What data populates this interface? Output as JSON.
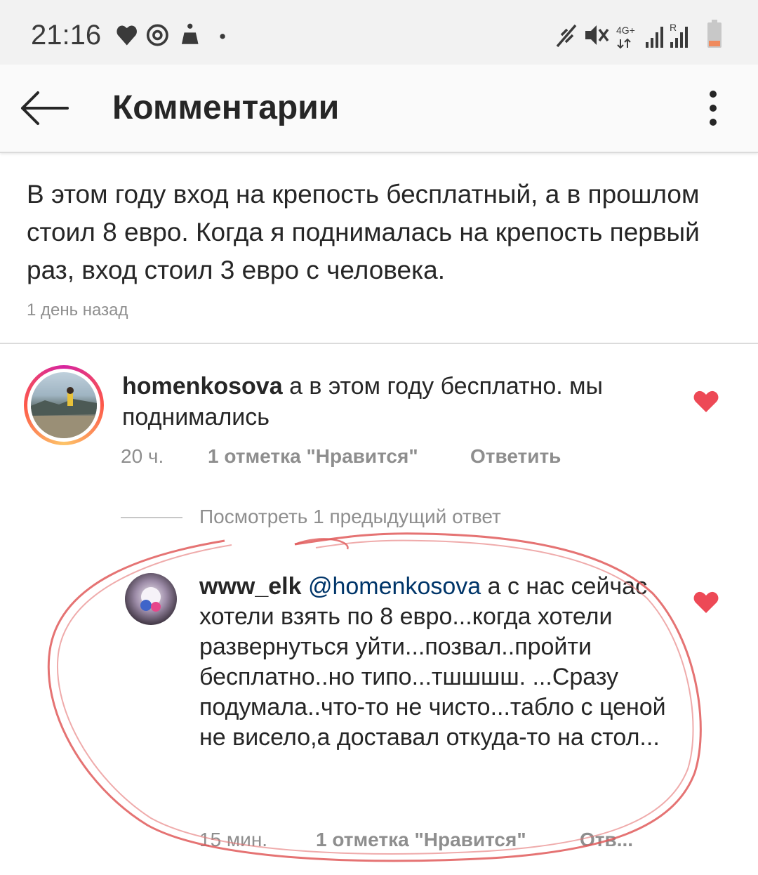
{
  "status_bar": {
    "time": "21:16",
    "left_icons": [
      "heart-icon",
      "notification-icon",
      "app-icon",
      "dot-icon"
    ],
    "right_icons": [
      "silent-icon",
      "mute-icon",
      "4g-icon",
      "signal-icon",
      "roaming-signal-icon",
      "battery-icon"
    ],
    "network_label": "4G+",
    "roaming_label": "R"
  },
  "header": {
    "title": "Комментарии"
  },
  "post": {
    "caption": "В этом году вход на крепость бесплатный, а в прошлом стоил 8 евро. Когда я поднималась на крепость первый раз, вход стоил 3 евро с человека.",
    "time": "1 день назад"
  },
  "comments": [
    {
      "username": "homenkosova",
      "text": "а в этом году бесплатно. мы поднимались",
      "time": "20 ч.",
      "likes": "1 отметка \"Нравится\"",
      "reply_label": "Ответить",
      "liked": true
    }
  ],
  "view_replies_label": "Посмотреть 1 предыдущий ответ",
  "reply": {
    "username": "www_elk",
    "mention": "@homenkosova",
    "text": "а с нас сейчас хотели взять по 8 евро...когда хотели развернуться уйти...позвал..пройти бесплатно..но типо...тшшшш. ...Сразу подумала..что-то не чисто...табло с ценой не висело,а доставал откуда-то на стол...",
    "time": "15 мин.",
    "likes": "1 отметка \"Нравится\"",
    "reply_label": "Отв...",
    "liked": true
  },
  "colors": {
    "heart": "#ed4956",
    "mention": "#003569",
    "meta": "#8e8e8e",
    "annotation": "#e05a5a"
  }
}
